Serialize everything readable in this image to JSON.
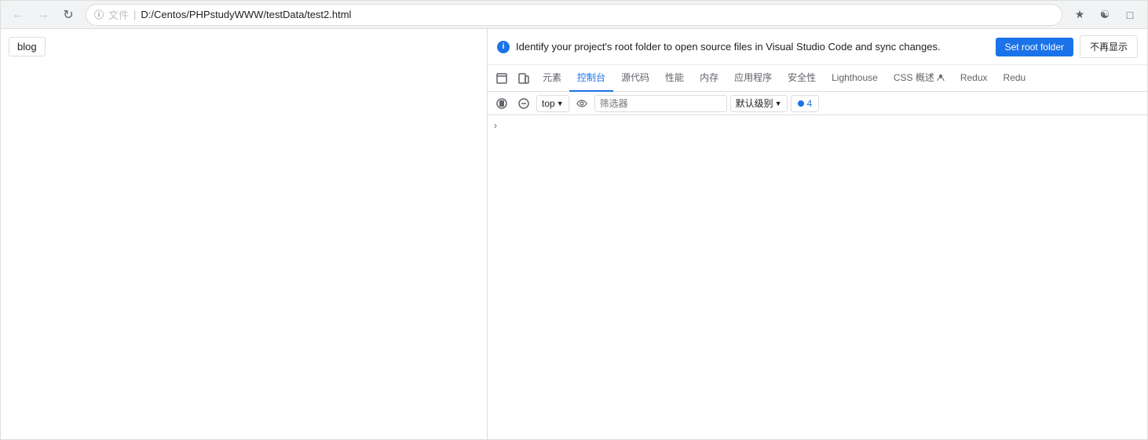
{
  "browser": {
    "url": "D:/Centos/PHPstudyWWW/testData/test2.html",
    "url_prefix": "文件",
    "separator": "|"
  },
  "page": {
    "tab_label": "blog"
  },
  "devtools": {
    "info_bar": {
      "message": "Identify your project's root folder to open source files in Visual Studio Code and sync changes.",
      "set_root_label": "Set root folder",
      "dismiss_label": "不再显示"
    },
    "tabs": [
      {
        "label": "元素",
        "id": "elements"
      },
      {
        "label": "控制台",
        "id": "console",
        "active": true
      },
      {
        "label": "源代码",
        "id": "sources"
      },
      {
        "label": "性能",
        "id": "performance"
      },
      {
        "label": "内存",
        "id": "memory"
      },
      {
        "label": "应用程序",
        "id": "application"
      },
      {
        "label": "安全性",
        "id": "security"
      },
      {
        "label": "Lighthouse",
        "id": "lighthouse"
      },
      {
        "label": "CSS 概述",
        "id": "css-overview"
      },
      {
        "label": "Redux",
        "id": "redux"
      },
      {
        "label": "Redu",
        "id": "redu2"
      }
    ],
    "console": {
      "top_selector": "top",
      "filter_placeholder": "筛选器",
      "level_label": "默认级别",
      "issues_count": "4",
      "expand_arrow": "›"
    }
  }
}
